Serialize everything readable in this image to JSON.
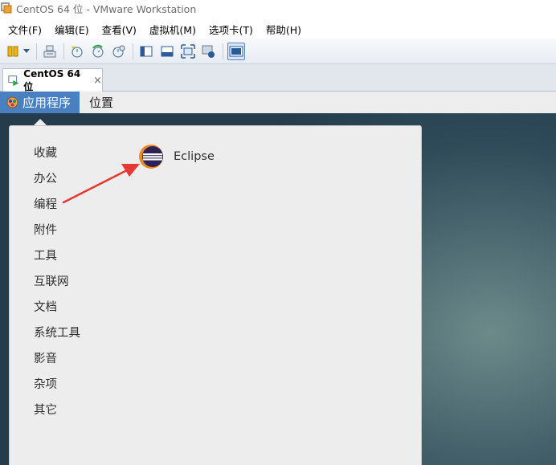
{
  "window": {
    "title": "CentOS 64 位 - VMware Workstation"
  },
  "menubar": {
    "items": [
      "文件(F)",
      "编辑(E)",
      "查看(V)",
      "虚拟机(M)",
      "选项卡(T)",
      "帮助(H)"
    ]
  },
  "toolbar": {
    "icons": [
      "pause-icon",
      "dropdown-arrow-icon",
      "send-keys-icon",
      "snapshot-icon",
      "revert-snapshot-icon",
      "snapshot-manager-icon",
      "console-view-icon",
      "fit-guest-icon",
      "fullscreen-icon",
      "unity-icon",
      "view-mode-icon"
    ]
  },
  "tabs": [
    {
      "label": "CentOS 64 位",
      "close": "×"
    }
  ],
  "gnome": {
    "applications_label": "应用程序",
    "places_label": "位置"
  },
  "apps_menu": {
    "categories": [
      "收藏",
      "办公",
      "编程",
      "附件",
      "工具",
      "互联网",
      "文档",
      "系统工具",
      "影音",
      "杂项",
      "其它"
    ],
    "apps": [
      {
        "label": "Eclipse",
        "icon": "eclipse-icon"
      }
    ]
  },
  "colors": {
    "applications_button": "#4a7fc1",
    "annotation_arrow": "#e53935"
  }
}
